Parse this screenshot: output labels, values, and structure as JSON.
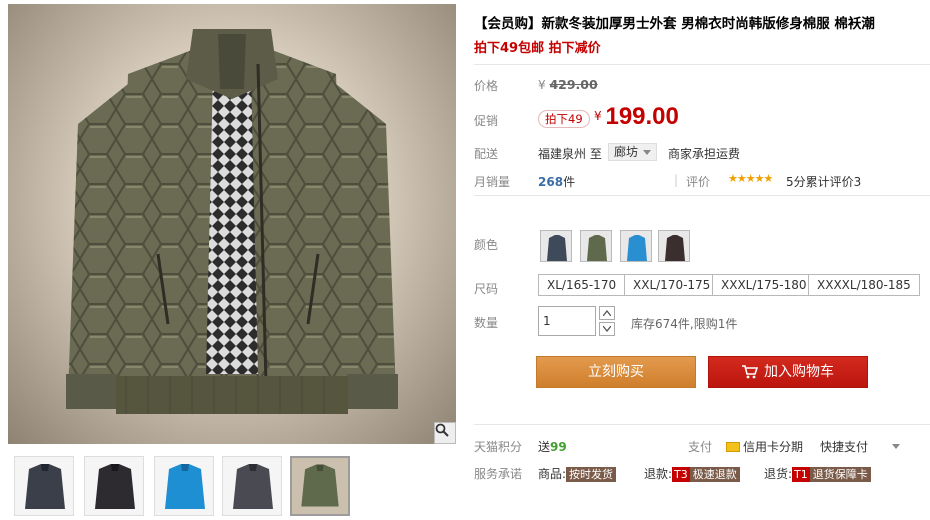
{
  "product": {
    "title": "【会员购】新款冬装加厚男士外套 男棉衣时尚韩版修身棉服 棉袄潮",
    "promo_line": "拍下49包邮 拍下减价"
  },
  "price": {
    "label": "价格",
    "currency": "¥",
    "original": "429.00",
    "promo_label": "促销",
    "promo_badge": "拍下49",
    "promo_value": "199.00"
  },
  "shipping": {
    "label": "配送",
    "from": "福建泉州 至",
    "to": "廊坊",
    "fee": "商家承担运费"
  },
  "sales": {
    "label": "月销量",
    "count": "268",
    "unit": "件",
    "divider": "|",
    "rating_label": "评价",
    "stars": "★★★★★",
    "rating_text": "5分累计评价3"
  },
  "options": {
    "color_label": "颜色",
    "colors": [
      "#3e4a5a",
      "#5f6a4c",
      "#2a8fd0",
      "#3a2e2e"
    ],
    "size_label": "尺码",
    "sizes": [
      "XL/165-170",
      "XXL/170-175",
      "XXXL/175-180",
      "XXXXL/180-185"
    ],
    "qty_label": "数量",
    "qty_value": "1",
    "stock": "库存674件,限购1件"
  },
  "actions": {
    "buy_now": "立刻购买",
    "add_to_cart": "加入购物车"
  },
  "services": {
    "points_label": "天猫积分",
    "points_prefix": "送",
    "points_value": "99",
    "pay_label": "支付",
    "credit": "信用卡分期",
    "quick_pay": "快捷支付",
    "promise_label": "服务承诺",
    "goods_label": "商品:",
    "goods_tag": "按时发货",
    "refund_label": "退款:",
    "refund_code": "T3",
    "refund_tag": "极速退款",
    "return_label": "退货:",
    "return_code": "T1",
    "return_tag": "退货保障卡"
  },
  "gallery": {
    "thumb_colors": [
      "#3a3f4a",
      "#2e2b30",
      "#1f8fd3",
      "#4a4a52",
      "#5f6a4c"
    ],
    "zoom_icon": "magnifier-icon"
  }
}
